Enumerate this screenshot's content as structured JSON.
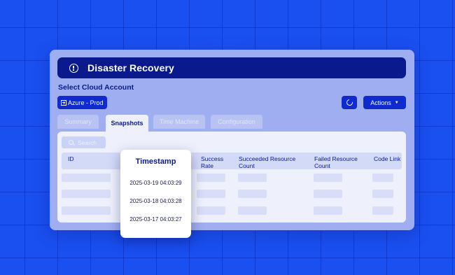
{
  "header": {
    "title": "Disaster Recovery"
  },
  "account": {
    "section_label": "Select Cloud Account",
    "selected": "Azure - Prod"
  },
  "toolbar": {
    "actions_label": "Actions"
  },
  "tabs": [
    {
      "label": "Summary",
      "active": false
    },
    {
      "label": "Snapshots",
      "active": true
    },
    {
      "label": "Time Machine",
      "active": false
    },
    {
      "label": "Configuration",
      "active": false
    }
  ],
  "table": {
    "search_placeholder": "Search",
    "columns": [
      {
        "label": "ID"
      },
      {
        "label": "Timestamp"
      },
      {
        "label": "Success Rate"
      },
      {
        "label": "Succeeded Resource Count"
      },
      {
        "label": "Failed Resource Count"
      },
      {
        "label": "Code Link"
      }
    ],
    "timestamps": [
      "2025-03-19 04:03:29",
      "2025-03-18 04:03:28",
      "2025-03-17 04:03:27"
    ]
  },
  "icons": {
    "title": "info-icon",
    "account": "plus-square-icon",
    "refresh": "refresh-icon",
    "actions": "chevron-down-icon",
    "search": "search-icon"
  },
  "colors": {
    "background": "#1a4ff0",
    "card": "#9faef0",
    "title_bar": "#0a1a8c",
    "primary_button": "#0f2bd0",
    "panel": "#eef1fc"
  }
}
